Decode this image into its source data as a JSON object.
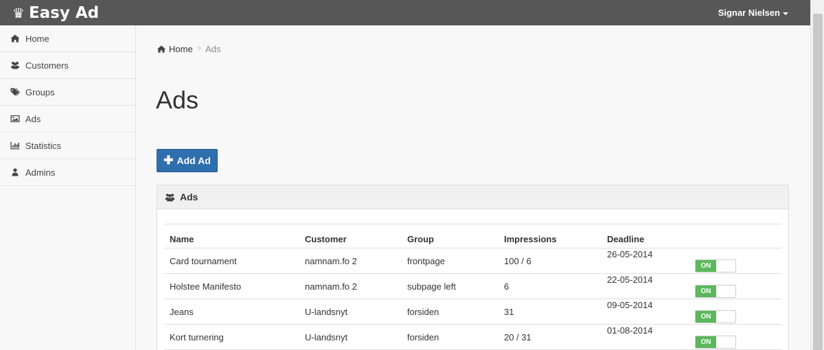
{
  "app": {
    "brand": "Easy Ad",
    "user_name": "Signar Nielsen"
  },
  "sidebar": {
    "items": [
      {
        "label": "Home",
        "icon": "home-icon"
      },
      {
        "label": "Customers",
        "icon": "users-icon"
      },
      {
        "label": "Groups",
        "icon": "tags-icon"
      },
      {
        "label": "Ads",
        "icon": "picture-icon"
      },
      {
        "label": "Statistics",
        "icon": "bar-chart-icon"
      },
      {
        "label": "Admins",
        "icon": "user-icon"
      }
    ]
  },
  "breadcrumb": {
    "home": "Home",
    "current": "Ads"
  },
  "page": {
    "title": "Ads",
    "add_button": "Add Ad"
  },
  "panel": {
    "title": "Ads",
    "columns": [
      "Name",
      "Customer",
      "Group",
      "Impressions",
      "Deadline"
    ],
    "rows": [
      {
        "name": "Card tournament",
        "customer": "namnam.fo 2",
        "group": "frontpage",
        "impressions": "100 / 6",
        "deadline": "26-05-2014",
        "toggle": "ON"
      },
      {
        "name": "Holstee Manifesto",
        "customer": "namnam.fo 2",
        "group": "subpage left",
        "impressions": "6",
        "deadline": "22-05-2014",
        "toggle": "ON"
      },
      {
        "name": "Jeans",
        "customer": "U-landsnyt",
        "group": "forsiden",
        "impressions": "31",
        "deadline": "09-05-2014",
        "toggle": "ON"
      },
      {
        "name": "Kort turnering",
        "customer": "U-landsnyt",
        "group": "forsiden",
        "impressions": "20 / 31",
        "deadline": "01-08-2014",
        "toggle": "ON"
      }
    ]
  },
  "colors": {
    "navbar": "#575757",
    "primary_button": "#2f6fad",
    "toggle_on": "#5cb85c"
  }
}
